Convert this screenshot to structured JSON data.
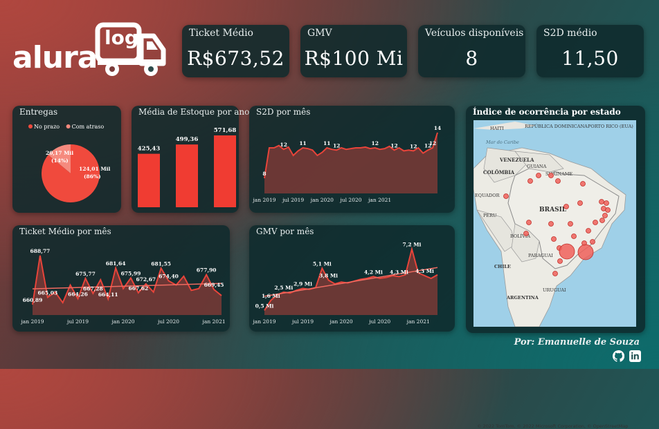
{
  "brand": {
    "name": "alura",
    "badge": "log"
  },
  "kpis": [
    {
      "title": "Ticket Médio",
      "value": "R$673,52"
    },
    {
      "title": "GMV",
      "value": "R$100 Mi"
    },
    {
      "title": "Veículos disponíveis",
      "value": "8"
    },
    {
      "title": "S2D médio",
      "value": "11,50"
    }
  ],
  "signature": "Por: Emanuelle de Souza",
  "chart_data": [
    {
      "id": "entregas",
      "type": "pie",
      "title": "Entregas",
      "legend": [
        "No prazo",
        "Com atraso"
      ],
      "legend_position": "top",
      "slices": [
        {
          "name": "No prazo",
          "value": 124.01,
          "label_value": "124,01 Mil",
          "label_pct": "(86%)",
          "color": "#f04a3d"
        },
        {
          "name": "Com atraso",
          "value": 20.17,
          "label_value": "20,17 Mil",
          "label_pct": "(14%)",
          "color": "#f58a7e"
        }
      ]
    },
    {
      "id": "estoque",
      "type": "bar",
      "title": "Média de Estoque por ano",
      "values": [
        425.43,
        499.36,
        571.68
      ],
      "labels": [
        "425,43",
        "499,36",
        "571,68"
      ],
      "color": "#f03c32"
    },
    {
      "id": "s2d",
      "type": "area",
      "title": "S2D por mês",
      "x_ticks": [
        "jan 2019",
        "jul 2019",
        "jan 2020",
        "jul 2020",
        "jan 2021"
      ],
      "ylim": [
        6,
        15
      ],
      "values": [
        8,
        12,
        12,
        12.3,
        11.8,
        12.1,
        11,
        11.6,
        12,
        11.9,
        11.7,
        11,
        11.4,
        12,
        11.8,
        11.7,
        12,
        11.8,
        11.9,
        12,
        12,
        12.1,
        11.9,
        12,
        11.8,
        11.9,
        12.2,
        11.7,
        12,
        11.6,
        11.7,
        11.6,
        12,
        11.3,
        11.7,
        12,
        14
      ],
      "point_labels": [
        {
          "i": 0,
          "text": "8"
        },
        {
          "i": 4,
          "text": "12"
        },
        {
          "i": 8,
          "text": "11"
        },
        {
          "i": 13,
          "text": "11"
        },
        {
          "i": 15,
          "text": "12"
        },
        {
          "i": 23,
          "text": "12"
        },
        {
          "i": 27,
          "text": "12"
        },
        {
          "i": 31,
          "text": "12"
        },
        {
          "i": 34,
          "text": "12"
        },
        {
          "i": 35,
          "text": "12"
        },
        {
          "i": 36,
          "text": "14"
        }
      ],
      "line_color": "#e8443a"
    },
    {
      "id": "ticket",
      "type": "area",
      "title": "Ticket Médio por mês",
      "x_ticks": [
        "jan 2019",
        "jul 2019",
        "jan 2020",
        "jul 2020",
        "jan 2021"
      ],
      "ylim": [
        655,
        695
      ],
      "values": [
        660.89,
        688.77,
        665.03,
        668,
        662,
        672,
        664.26,
        675.77,
        667.28,
        675,
        664.11,
        681.64,
        670,
        675.99,
        667.62,
        672.67,
        668,
        681.55,
        674.4,
        672,
        677,
        669,
        670,
        677.9,
        669.45,
        666
      ],
      "point_labels": [
        {
          "i": 0,
          "text": "660,89"
        },
        {
          "i": 1,
          "text": "688,77"
        },
        {
          "i": 2,
          "text": "665,03"
        },
        {
          "i": 6,
          "text": "664,26"
        },
        {
          "i": 7,
          "text": "675,77"
        },
        {
          "i": 8,
          "text": "667,28"
        },
        {
          "i": 10,
          "text": "664,11"
        },
        {
          "i": 11,
          "text": "681,64"
        },
        {
          "i": 13,
          "text": "675,99"
        },
        {
          "i": 14,
          "text": "667,62"
        },
        {
          "i": 15,
          "text": "672,67"
        },
        {
          "i": 17,
          "text": "681,55"
        },
        {
          "i": 18,
          "text": "674,40"
        },
        {
          "i": 23,
          "text": "677,90"
        },
        {
          "i": 24,
          "text": "669,45"
        }
      ],
      "trendline": true,
      "line_color": "#e8443a"
    },
    {
      "id": "gmv",
      "type": "area",
      "title": "GMV por mês",
      "x_ticks": [
        "jan 2019",
        "jul 2019",
        "jan 2020",
        "jul 2020",
        "jan 2021"
      ],
      "ylim": [
        0,
        8
      ],
      "values": [
        0.5,
        1.6,
        2.2,
        2.5,
        2.4,
        2.7,
        2.9,
        2.8,
        3.0,
        5.1,
        3.8,
        3.4,
        3.6,
        3.5,
        3.7,
        3.9,
        4.0,
        4.2,
        4.0,
        4.1,
        4.3,
        4.2,
        4.4,
        7.2,
        4.6,
        4.3,
        4.0,
        4.4
      ],
      "point_labels": [
        {
          "i": 0,
          "text": "0,5 Mi"
        },
        {
          "i": 1,
          "text": "1,6 Mi"
        },
        {
          "i": 3,
          "text": "2,5 Mi"
        },
        {
          "i": 6,
          "text": "2,9 Mi"
        },
        {
          "i": 9,
          "text": "5,1 Mi"
        },
        {
          "i": 10,
          "text": "3,8 Mi"
        },
        {
          "i": 17,
          "text": "4,2 Mi"
        },
        {
          "i": 21,
          "text": "4,3 Mi"
        },
        {
          "i": 23,
          "text": "7,2 Mi"
        },
        {
          "i": 25,
          "text": "4,3 Mi"
        }
      ],
      "trendline": true,
      "line_color": "#e8443a"
    }
  ],
  "map": {
    "title": "Índice de ocorrência por estado",
    "labels": [
      "HAITI",
      "REPÚBLICA DOMINICANA",
      "PORTO RICO (EUA)",
      "Mar do Caribe",
      "VENEZUELA",
      "COLÔMBIA",
      "GUIANA",
      "SURINAME",
      "EQUADOR",
      "BRASIL",
      "PERU",
      "BOLÍVIA",
      "PARAGUAI",
      "CHILE",
      "URUGUAI",
      "ARGENTINA"
    ],
    "attribution": "© 2022 TomTom, © 2022 Microsoft Corporation, © OpenStreetMap"
  }
}
